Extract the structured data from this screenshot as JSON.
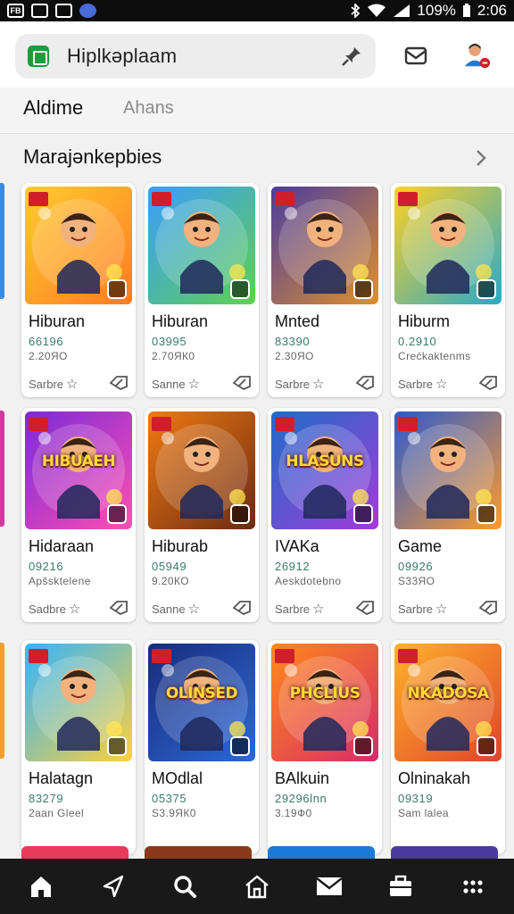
{
  "status_bar": {
    "left_icons": [
      "notification-icon",
      "image-icon",
      "shield-icon",
      "app-icon"
    ],
    "left_labels": [
      "FB",
      "",
      "",
      ""
    ],
    "battery": "109%",
    "time": "2:06"
  },
  "search": {
    "text": "Hiplkəplaam"
  },
  "tabs": [
    {
      "label": "Aldime",
      "active": true
    },
    {
      "label": "Ahans",
      "active": false
    }
  ],
  "section": {
    "title": "Marajənkepbies"
  },
  "cards": [
    {
      "title": "Hiburan",
      "num": "66196",
      "sub": "2.20ЯО",
      "foot": "Sarbre",
      "colors": [
        "#ffcc30",
        "#ff7a22"
      ]
    },
    {
      "title": "Hiburan",
      "num": "03995",
      "sub": "2.70ЯК0",
      "foot": "Sanne",
      "colors": [
        "#3a9dff",
        "#5fd04e"
      ]
    },
    {
      "title": "Mnted",
      "num": "83390",
      "sub": "2.30ЯО",
      "foot": "Sarbre",
      "colors": [
        "#4a3ca0",
        "#e0902a"
      ]
    },
    {
      "title": "Hiburm",
      "num": "0.2910",
      "sub": "Crećkaktenms",
      "foot": "Sarbre",
      "colors": [
        "#ffd024",
        "#27a9c9"
      ]
    },
    {
      "title": "Hidaraan",
      "num": "09216",
      "sub": "Apšsktelene",
      "foot": "Sadbre",
      "colors": [
        "#7a2ad8",
        "#ff4fb2"
      ],
      "banner": "HIBUAEH"
    },
    {
      "title": "Hiburab",
      "num": "05949",
      "sub": "9.20КО",
      "foot": "Sanne",
      "colors": [
        "#f07a12",
        "#6a2a12"
      ]
    },
    {
      "title": "IVAKa",
      "num": "26912",
      "sub": "Aeskdotebno",
      "foot": "Sarbre",
      "colors": [
        "#1e6dc8",
        "#a43ad8"
      ],
      "banner": "HLASUNS"
    },
    {
      "title": "Game",
      "num": "09926",
      "sub": "S33ЯО",
      "foot": "Sarbre",
      "colors": [
        "#2a5ad0",
        "#ff9a2a"
      ]
    },
    {
      "title": "Halatagn",
      "num": "83279",
      "sub": "2aan Gleel",
      "foot": "",
      "colors": [
        "#32b4ff",
        "#ffd03a"
      ]
    },
    {
      "title": "MOdlal",
      "num": "05375",
      "sub": "S3.9ЯК0",
      "foot": "",
      "colors": [
        "#1a2a7a",
        "#2a6ad8"
      ],
      "banner": "OLINSED"
    },
    {
      "title": "BAlkuin",
      "num": "29296lnn",
      "sub": "3.19Ф0",
      "foot": "",
      "colors": [
        "#ff8a1a",
        "#d82a6a"
      ],
      "banner": "PHCLIUS"
    },
    {
      "title": "Olninakah",
      "num": "09319",
      "sub": "Sam lalea",
      "foot": "",
      "colors": [
        "#ffb22a",
        "#e0442a"
      ],
      "banner": "NKADOSA"
    }
  ],
  "icons": {
    "search_pin": "pin-icon",
    "mail": "mail-icon",
    "account": "account-icon",
    "chevron": "chevron-right-icon",
    "star": "star-icon",
    "share": "tag-icon"
  },
  "bottom_nav": [
    "home-icon",
    "send-icon",
    "search-icon",
    "house-icon",
    "mail-icon",
    "briefcase-icon",
    "more-icon"
  ],
  "accent": "#d01f2b"
}
